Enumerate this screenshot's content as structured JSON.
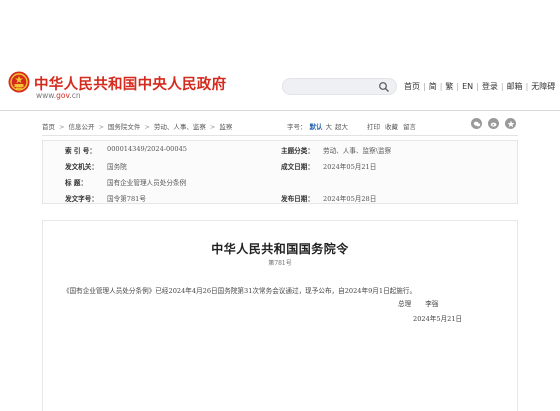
{
  "header": {
    "site_title": "中华人民共和国中央人民政府",
    "site_url_prefix": "www.",
    "site_url_gov": "gov",
    "site_url_suffix": ".cn",
    "search_placeholder": "",
    "nav": [
      "首页",
      "简",
      "繁",
      "EN",
      "登录",
      "邮箱",
      "无障碍"
    ],
    "colors": {
      "brand_red": "#d52b1e",
      "accent_blue": "#2b66b3"
    }
  },
  "breadcrumb": {
    "items": [
      "首页",
      "信息公开",
      "国务院文件",
      "劳动、人事、监察",
      "监察"
    ],
    "font_size_label": "字号：",
    "font_sizes": [
      "默认",
      "大",
      "超大"
    ],
    "tools": [
      "打印",
      "收藏",
      "留言"
    ],
    "share_icons": [
      "wechat-icon",
      "weibo-icon",
      "qzone-icon"
    ]
  },
  "meta": {
    "index_label": "索  引  号：",
    "index_value": "000014349/2024-00045",
    "category_label": "主题分类：",
    "category_value": "劳动、人事、监察\\监察",
    "issuer_label": "发文机关：",
    "issuer_value": "国务院",
    "written_label": "成文日期：",
    "written_value": "2024年05月21日",
    "title_label": "标    题：",
    "title_value": "国有企业管理人员处分条例",
    "docno_label": "发文字号：",
    "docno_value": "国令第781号",
    "published_label": "发布日期：",
    "published_value": "2024年05月28日"
  },
  "document": {
    "title": "中华人民共和国国务院令",
    "number": "第781号",
    "body": "《国有企业管理人员处分条例》已经2024年4月26日国务院第31次常务会议通过，现予公布，自2024年9月1日起施行。",
    "signer_title": "总理",
    "signer_name": "李强",
    "date": "2024年5月21日"
  }
}
